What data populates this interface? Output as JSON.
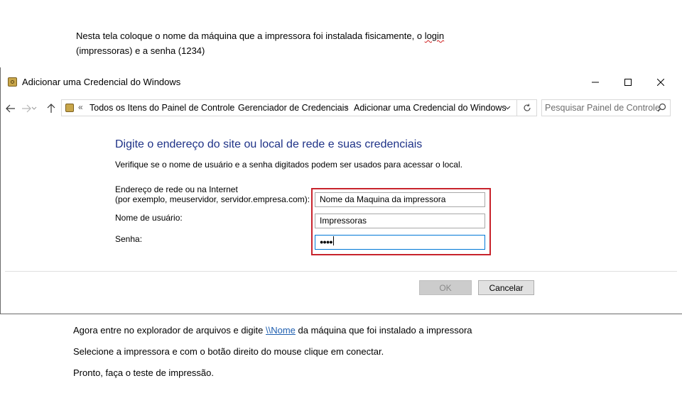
{
  "doc": {
    "intro_line1_before": "Nesta tela coloque o nome da máquina que a impressora foi instalada fisicamente, o ",
    "intro_line1_word": "login",
    "intro_line2": "(impressoras) e a senha (1234)",
    "step1_before": "Agora entre no explorador de arquivos e digite ",
    "step1_link": "\\\\Nome",
    "step1_after": " da máquina que foi instalado a impressora",
    "step2": "Selecione a impressora e com o botão direito do mouse clique em conectar.",
    "step3": "Pronto, faça o teste de impressão."
  },
  "window": {
    "title": "Adicionar uma Credencial do Windows",
    "icon": "credential-manager-icon"
  },
  "address_bar": {
    "overflow": "«",
    "breadcrumbs": [
      "Todos os Itens do Painel de Controle",
      "Gerenciador de Credenciais",
      "Adicionar uma Credencial do Windows"
    ],
    "separator": "›"
  },
  "search": {
    "placeholder": "Pesquisar Painel de Controle"
  },
  "form": {
    "heading": "Digite o endereço do site ou local de rede e suas credenciais",
    "subtext": "Verifique se o nome de usuário e a senha digitados podem ser usados para acessar o local.",
    "address_label_1": "Endereço de rede ou na Internet",
    "address_label_2": "(por exemplo, meuservidor, servidor.empresa.com):",
    "address_value": "Nome da Maquina da impressora",
    "user_label": "Nome de usuário:",
    "user_value": "Impressoras",
    "password_label": "Senha:",
    "password_value": "●●●●"
  },
  "buttons": {
    "ok": "OK",
    "cancel": "Cancelar"
  },
  "colors": {
    "heading": "#1e3287",
    "highlight": "#c8232c",
    "link": "#1f5fb0"
  }
}
